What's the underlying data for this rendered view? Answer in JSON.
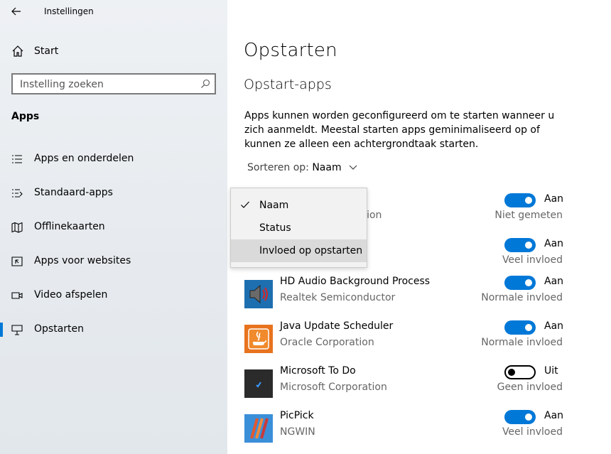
{
  "window": {
    "title": "Instellingen"
  },
  "sidebar": {
    "home_label": "Start",
    "search_placeholder": "Instelling zoeken",
    "section": "Apps",
    "items": [
      {
        "label": "Apps en onderdelen",
        "icon": "list-icon"
      },
      {
        "label": "Standaard-apps",
        "icon": "default-apps-icon"
      },
      {
        "label": "Offlinekaarten",
        "icon": "map-icon"
      },
      {
        "label": "Apps voor websites",
        "icon": "web-apps-icon"
      },
      {
        "label": "Video afspelen",
        "icon": "video-icon"
      },
      {
        "label": "Opstarten",
        "icon": "startup-icon",
        "selected": true
      }
    ]
  },
  "main": {
    "title": "Opstarten",
    "subtitle": "Opstart-apps",
    "description": "Apps kunnen worden geconfigureerd om te starten wanneer u zich aanmeldt. Meestal starten apps geminimaliseerd op of kunnen ze alleen een achtergrondtaak starten.",
    "sort_label": "Sorteren op:",
    "sort_value": "Naam",
    "apps": [
      {
        "name": "",
        "publisher": "ation",
        "state": "Aan",
        "on": true,
        "impact": "Niet gemeten"
      },
      {
        "name": "",
        "publisher": "",
        "state": "Aan",
        "on": true,
        "impact": "Veel invloed"
      },
      {
        "name": "HD Audio Background Process",
        "publisher": "Realtek Semiconductor",
        "state": "Aan",
        "on": true,
        "impact": "Normale invloed",
        "icon": "speaker-icon"
      },
      {
        "name": "Java Update Scheduler",
        "publisher": "Oracle Corporation",
        "state": "Aan",
        "on": true,
        "impact": "Normale invloed",
        "icon": "java-icon"
      },
      {
        "name": "Microsoft To Do",
        "publisher": "Microsoft Corporation",
        "state": "Uit",
        "on": false,
        "impact": "Geen invloed",
        "icon": "todo-icon"
      },
      {
        "name": "PicPick",
        "publisher": "NGWIN",
        "state": "Aan",
        "on": true,
        "impact": "Veel invloed",
        "icon": "picpick-icon"
      }
    ]
  },
  "dropdown": {
    "options": [
      {
        "label": "Naam",
        "checked": true
      },
      {
        "label": "Status",
        "checked": false
      },
      {
        "label": "Invloed op opstarten",
        "checked": false,
        "hovered": true
      }
    ]
  },
  "colors": {
    "accent": "#0078d7",
    "secondary_text": "#666666",
    "sidebar_bg": "#e8ecf0"
  }
}
